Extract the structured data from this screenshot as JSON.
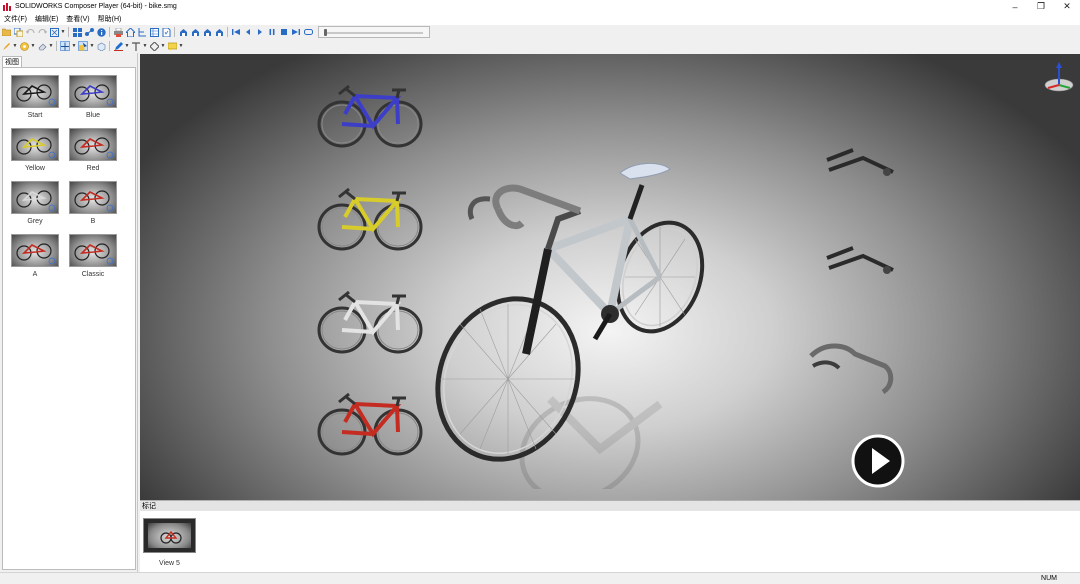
{
  "window": {
    "title": "SOLIDWORKS Composer Player (64-bit) - bike.smg",
    "controls": [
      "–",
      "❐",
      "✕"
    ]
  },
  "menu": [
    "文件(F)",
    "编辑(E)",
    "查看(V)",
    "帮助(H)"
  ],
  "toolbar": {
    "slider_progress": 0.0
  },
  "views_panel": {
    "tab": "视图",
    "views": [
      "Start",
      "Blue",
      "Yellow",
      "Red",
      "Grey",
      "B",
      "A",
      "Classic"
    ]
  },
  "markers_panel": {
    "header": "标记",
    "items": [
      "View 5"
    ]
  },
  "statusbar": {
    "num": "NUM"
  },
  "colors": {
    "blue": "#3d3ec8",
    "yellow": "#d8cc2a",
    "grey": "#d8d8d8",
    "red": "#c42c22",
    "accent": "#1f6fd1"
  }
}
